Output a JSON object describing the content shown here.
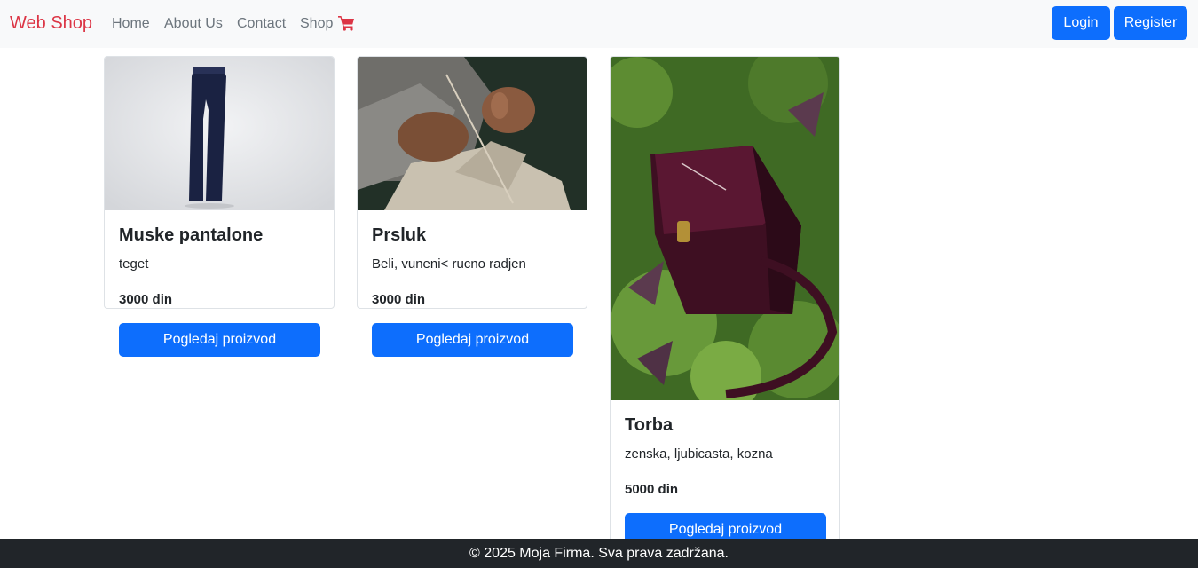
{
  "nav": {
    "brand": "Web Shop",
    "links": [
      "Home",
      "About Us",
      "Contact",
      "Shop"
    ],
    "login": "Login",
    "register": "Register",
    "brand_color": "#dc3545",
    "accent_color": "#0d6efd"
  },
  "products": [
    {
      "name": "Muske pantalone",
      "description": "teget",
      "price": "3000 din",
      "button": "Pogledaj proizvod"
    },
    {
      "name": "Prsluk",
      "description": "Beli, vuneni< rucno radjen",
      "price": "3000 din",
      "button": "Pogledaj proizvod"
    },
    {
      "name": "Torba",
      "description": "zenska, ljubicasta, kozna",
      "price": "5000 din",
      "button": "Pogledaj proizvod"
    }
  ],
  "footer": {
    "text": "© 2025 Moja Firma. Sva prava zadržana."
  }
}
